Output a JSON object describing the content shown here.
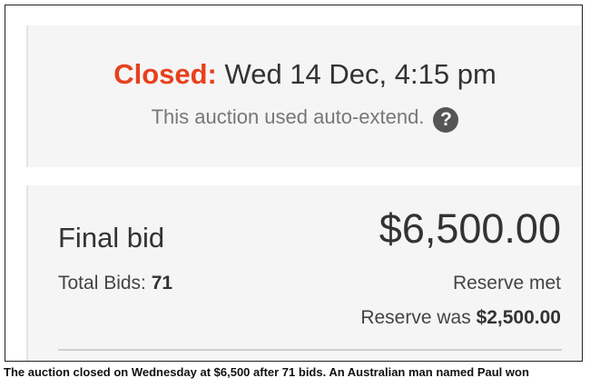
{
  "status": {
    "closed_label": "Closed:",
    "closed_datetime": "Wed 14 Dec, 4:15 pm",
    "auto_extend_note": "This auction used auto-extend.",
    "help_icon": "question-mark-circle-icon",
    "help_glyph": "?"
  },
  "bid_summary": {
    "final_bid_label": "Final bid",
    "final_bid_amount": "$6,500.00",
    "total_bids_label": "Total Bids:",
    "total_bids_value": "71",
    "reserve_status": "Reserve met",
    "reserve_was_label": "Reserve was",
    "reserve_was_amount": "$2,500.00"
  },
  "caption": "The auction closed on Wednesday at $6,500 after 71 bids. An Australian man named Paul won",
  "colors": {
    "closed_accent": "#e8401c",
    "panel_background": "#f5f5f5",
    "primary_text": "#333333",
    "secondary_text": "#777777"
  }
}
